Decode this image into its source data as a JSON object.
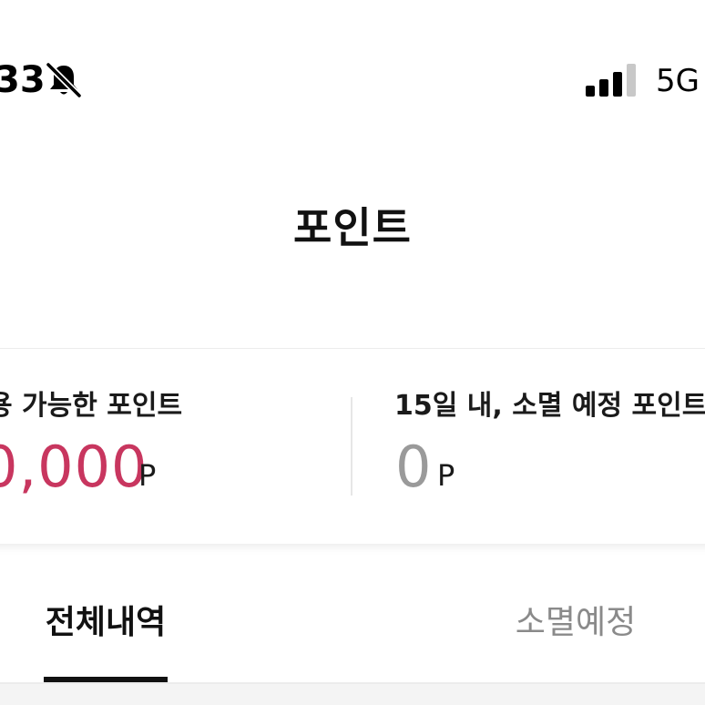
{
  "status_bar": {
    "time": "33",
    "network": "5G",
    "signal_level": 0.75,
    "icons": [
      "bell-off-icon",
      "signal-icon"
    ]
  },
  "header": {
    "title": "포인트"
  },
  "points": {
    "available_label": "용 가능한 포인트",
    "available_value": "0,000",
    "available_unit": "P",
    "expiring_label": "15일 내, 소멸 예정 포인트",
    "expiring_value": "0",
    "expiring_unit": "P"
  },
  "tabs": [
    {
      "label": "전체내역",
      "active": true
    },
    {
      "label": "소멸예정",
      "active": false
    }
  ],
  "colors": {
    "accent": "#c8365f",
    "muted_value": "#9a9a9a",
    "active_tab": "#111111",
    "inactive_tab": "#8a8a8a"
  }
}
